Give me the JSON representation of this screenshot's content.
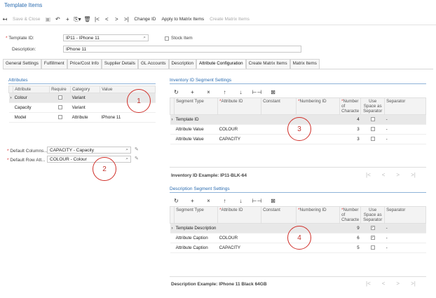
{
  "window": {
    "title": "Template Items"
  },
  "toolbar": {
    "undo_icon": "undo-arrow",
    "save_close": "Save & Close",
    "change_id": "Change ID",
    "apply_matrix": "Apply to Matrix Items",
    "create_matrix": "Create Matrix Items"
  },
  "header": {
    "template_id_label": "Template ID:",
    "template_id_value": "IP11 - IPhone 11",
    "stock_item_label": "Stock Item",
    "description_label": "Description:",
    "description_value": "IPhone 11"
  },
  "tabs": [
    "General Settings",
    "Fulfillment",
    "Price/Cost Info",
    "Supplier Details",
    "GL Accounts",
    "Description",
    "Attribute Configuration",
    "Create Matrix Items",
    "Matrix Items"
  ],
  "attributes": {
    "title": "Attributes",
    "columns": [
      "Attribute",
      "Require",
      "Category",
      "Value"
    ],
    "rows": [
      {
        "attribute": "Colour",
        "category": "Variant",
        "value": ""
      },
      {
        "attribute": "Capacity",
        "category": "Variant",
        "value": ""
      },
      {
        "attribute": "Model",
        "category": "Attribute",
        "value": "IPhone 11"
      }
    ]
  },
  "defaults": {
    "columns_label": "Default Columns...",
    "columns_value": "CAPACITY - Capacity",
    "rows_label": "Default Row Att...",
    "rows_value": "COLOUR - Colour"
  },
  "inventory_segments": {
    "title": "Inventory ID Segment Settings",
    "columns": [
      "Segment Type",
      "Attribute ID",
      "Constant",
      "Numbering ID",
      "Number of Characte",
      "Use Space as Separator",
      "Separator"
    ],
    "rows": [
      {
        "type": "Template ID",
        "attr": "",
        "num": "4",
        "sep": "-"
      },
      {
        "type": "Attribute Value",
        "attr": "COLOUR",
        "num": "3",
        "sep": "-"
      },
      {
        "type": "Attribute Value",
        "attr": "CAPACITY",
        "num": "3",
        "sep": "-"
      }
    ],
    "example_label": "Inventory ID Example: IP11-BLK-64"
  },
  "description_segments": {
    "title": "Description Segment Settings",
    "columns": [
      "Segment Type",
      "Attribute ID",
      "Constant",
      "Numbering ID",
      "Number of Characte",
      "Use Space as Separator",
      "Separator"
    ],
    "rows": [
      {
        "type": "Template Description",
        "attr": "",
        "num": "9",
        "sep": "-"
      },
      {
        "type": "Attribute Caption",
        "attr": "COLOUR",
        "num": "6",
        "sep": "-"
      },
      {
        "type": "Attribute Caption",
        "attr": "CAPACITY",
        "num": "5",
        "sep": "-"
      }
    ],
    "example_label": "Description Example: IPhone 11 Black 64GB"
  },
  "callouts": [
    "1",
    "2",
    "3",
    "4"
  ],
  "colors": {
    "accent": "#2b6cb0",
    "callout": "#d0302a"
  }
}
